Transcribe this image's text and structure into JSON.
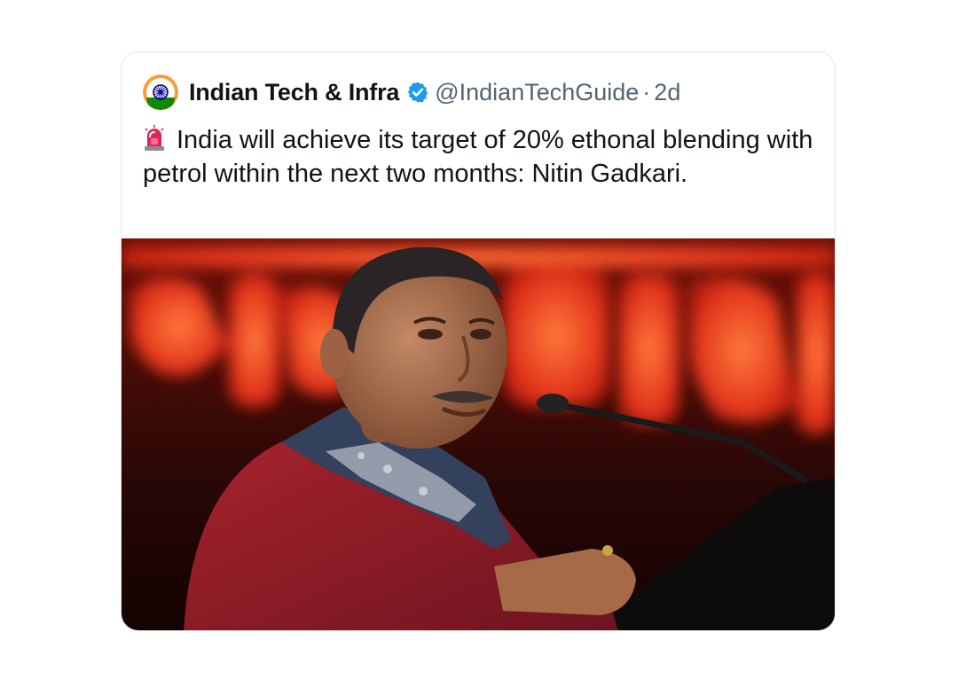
{
  "tweet": {
    "author": {
      "display_name": "Indian Tech & Infra",
      "handle": "@IndianTechGuide",
      "verified": true
    },
    "separator": "·",
    "timestamp": "2d",
    "emoji_icon": "rotating-light-siren-icon",
    "text": "India will achieve its target of 20% ethonal blending with petrol within the next two months: Nitin Gadkari.",
    "media": {
      "type": "photo",
      "subject": "man-speaking-at-microphone-on-stage"
    }
  },
  "colors": {
    "name": "#0f1419",
    "secondary": "#536471",
    "verified_blue": "#1d9bf0",
    "card_border": "#e6e6e6",
    "stage_backdrop_red": "#d8321c"
  }
}
